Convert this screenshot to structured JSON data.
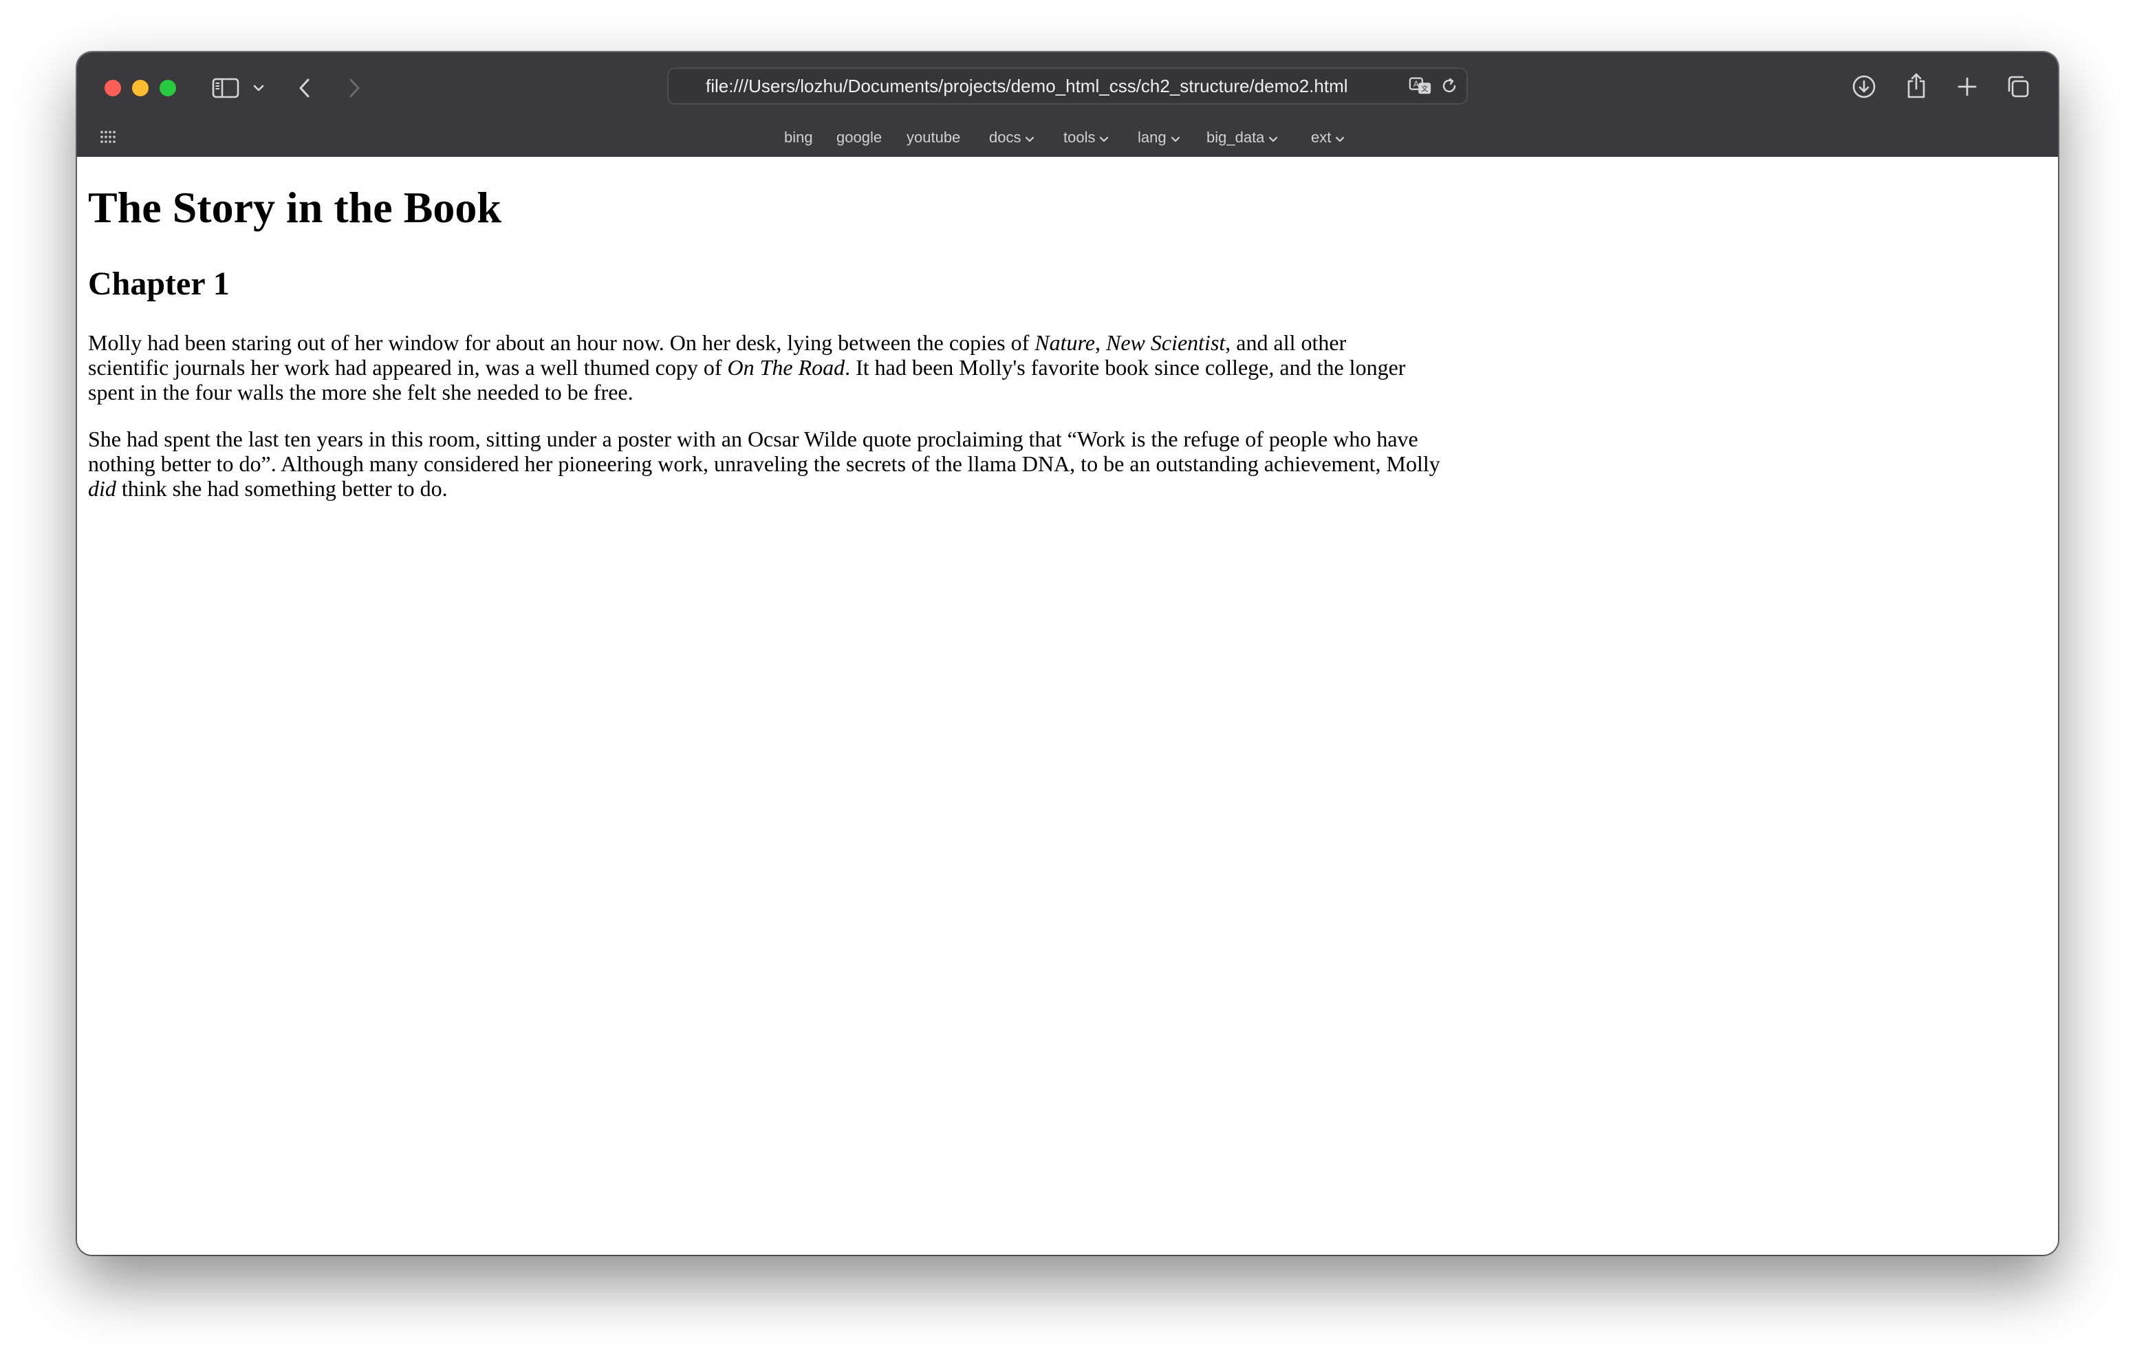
{
  "browser": {
    "url": "file:///Users/lozhu/Documents/projects/demo_html_css/ch2_structure/demo2.html",
    "bookmarks": [
      "bing",
      "google",
      "youtube",
      "docs",
      "tools",
      "lang",
      "big_data",
      "ext"
    ],
    "icons": [
      "sidebar-icon",
      "chevron-down-icon",
      "back-icon",
      "forward-icon",
      "translate-icon",
      "reload-icon",
      "download-icon",
      "share-icon",
      "new-tab-icon",
      "tabs-overview-icon",
      "apps-grid-icon"
    ]
  },
  "page": {
    "heading": "The Story in the Book",
    "chapter": "Chapter 1",
    "p1": {
      "l1a": "Molly had been staring out of her window for about an hour now. On her desk, lying between the copies of ",
      "l1_em1": "Nature",
      "l1b": ", ",
      "l1_em2": "New Scientist",
      "l1c": ", and all other",
      "l2a": "scientific journals her work had appeared in, was a well thumed copy of ",
      "l2_em": "On The Road",
      "l2b": ". It had been Molly's favorite book since college, and the longer",
      "l3": "spent in the four walls the more she felt she needed to be free."
    },
    "p2": {
      "l1": "She had spent the last ten years in this room, sitting under a poster with an Ocsar Wilde quote proclaiming that “Work is the refuge of people who have",
      "l2": "nothing better to do”. Although many considered her pioneering work, unraveling the secrets of the llama DNA, to be an outstanding achievement, Molly",
      "l3_em": "did",
      "l3b": " think she had something better to do."
    }
  }
}
